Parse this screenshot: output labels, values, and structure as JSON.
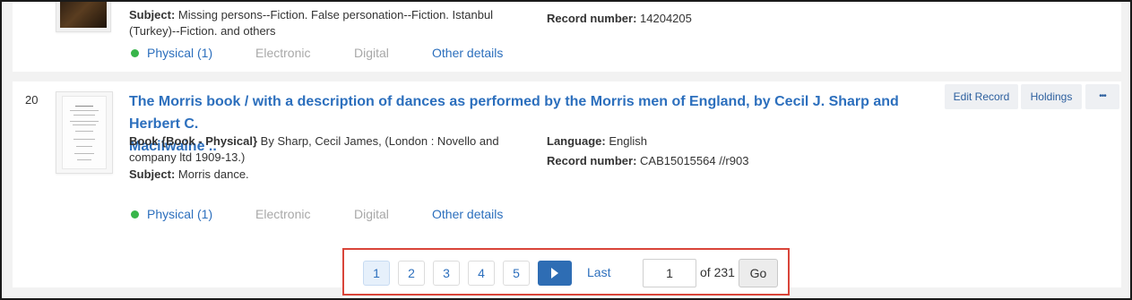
{
  "previous_record": {
    "subject_label": "Subject:",
    "subject_text_line1": "Missing persons--Fiction. False personation--Fiction. Istanbul",
    "subject_text_line2": "(Turkey)--Fiction. and others",
    "record_number_label": "Record number:",
    "record_number": "14204205",
    "availability": {
      "physical": "Physical (1)",
      "electronic": "Electronic",
      "digital": "Digital",
      "other_details": "Other details"
    }
  },
  "record": {
    "index": "20",
    "title_line1": "The Morris book / with a description of dances as performed by the Morris men of England, by Cecil J. Sharp and Herbert C.",
    "title_line2": "Macilwaine ..",
    "type": "Book {Book - Physical}",
    "details_line1": "By Sharp, Cecil James, (London : Novello and",
    "details_line2": "company ltd 1909-13.)",
    "subject_label": "Subject:",
    "subject": "Morris dance.",
    "language_label": "Language:",
    "language": "English",
    "record_number_label": "Record number:",
    "record_number": "CAB15015564 //r903",
    "actions": {
      "edit_record": "Edit Record",
      "holdings": "Holdings",
      "more": "•••"
    },
    "availability": {
      "physical": "Physical (1)",
      "electronic": "Electronic",
      "digital": "Digital",
      "other_details": "Other details"
    }
  },
  "pagination": {
    "pages": [
      "1",
      "2",
      "3",
      "4",
      "5"
    ],
    "current_page": "1",
    "last_label": "Last",
    "page_input_value": "1",
    "of_total": "of 231",
    "go_label": "Go"
  },
  "colors": {
    "link": "#2c6fbd",
    "available_dot": "#38b54a",
    "highlight_border": "#d9453a",
    "next_button": "#2e6db4"
  },
  "icons": {
    "next_page": "triangle-right",
    "availability_status": "green-dot"
  }
}
